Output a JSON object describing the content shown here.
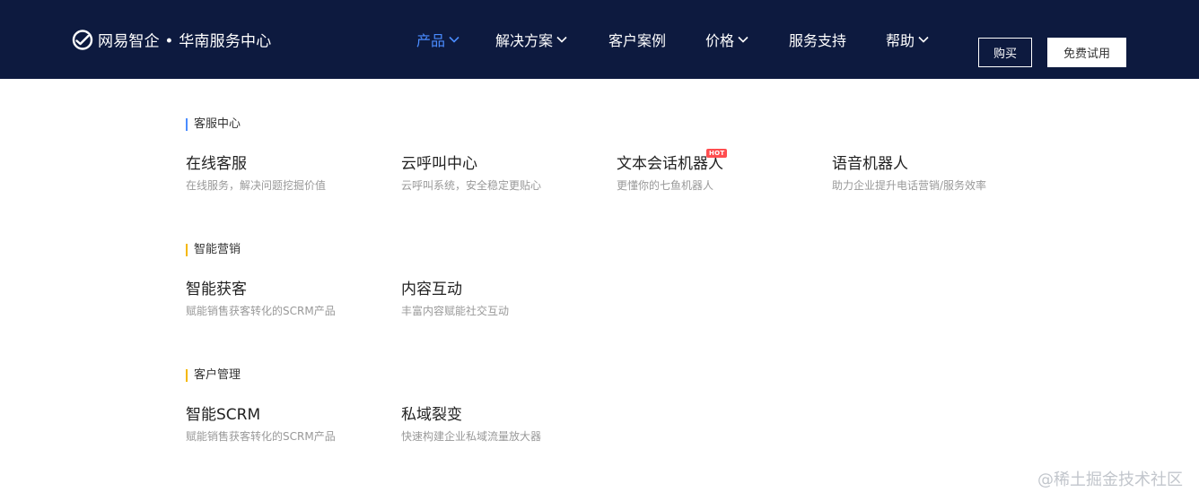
{
  "header": {
    "brand": "网易智企 • 华南服务中心",
    "nav": [
      {
        "label": "产品",
        "has_dropdown": true,
        "active": true
      },
      {
        "label": "解决方案",
        "has_dropdown": true,
        "active": false
      },
      {
        "label": "客户案例",
        "has_dropdown": false,
        "active": false
      },
      {
        "label": "价格",
        "has_dropdown": true,
        "active": false
      },
      {
        "label": "服务支持",
        "has_dropdown": false,
        "active": false
      },
      {
        "label": "帮助",
        "has_dropdown": true,
        "active": false
      }
    ],
    "buy_label": "购买",
    "trial_label": "免费试用"
  },
  "sections": [
    {
      "title": "客服中心",
      "items": [
        {
          "title": "在线客服",
          "desc": "在线服务，解决问题挖掘价值"
        },
        {
          "title": "云呼叫中心",
          "desc": "云呼叫系统，安全稳定更贴心"
        },
        {
          "title": "文本会话机器人",
          "desc": "更懂你的七鱼机器人",
          "badge": "HOT"
        },
        {
          "title": "语音机器人",
          "desc": "助力企业提升电话营销/服务效率"
        }
      ]
    },
    {
      "title": "智能营销",
      "items": [
        {
          "title": "智能获客",
          "desc": "赋能销售获客转化的SCRM产品"
        },
        {
          "title": "内容互动",
          "desc": "丰富内容赋能社交互动"
        }
      ]
    },
    {
      "title": "客户管理",
      "items": [
        {
          "title": "智能SCRM",
          "desc": "赋能销售获客转化的SCRM产品"
        },
        {
          "title": "私域裂变",
          "desc": "快速构建企业私域流量放大器"
        }
      ]
    }
  ],
  "watermark": "@稀土掘金技术社区",
  "colors": {
    "header_bg": "#0d1a3f",
    "active_nav": "#4a8cff",
    "section_bar_blue": "#4a8cff",
    "section_bar_gold": "#f5b800",
    "hot_badge": "#ff4d4f"
  },
  "icons": {
    "logo": "netease-zhiqi-logo-icon",
    "dropdown": "chevron-down-icon"
  }
}
